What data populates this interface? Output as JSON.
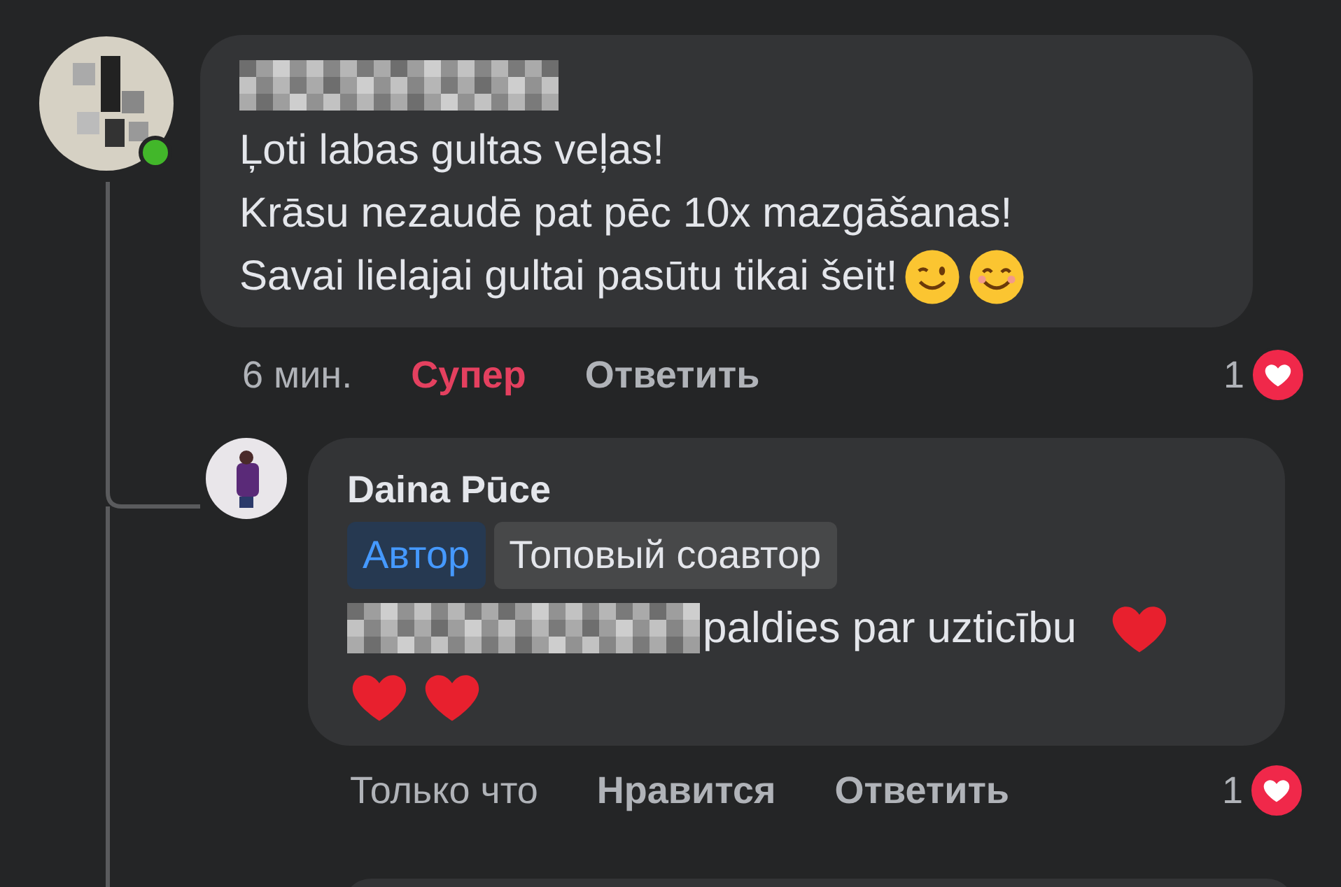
{
  "comments": [
    {
      "online": true,
      "lines": [
        "Ļoti labas gultas veļas!",
        "Krāsu nezaudē pat pēc 10x mazgāšanas!",
        "Savai lielajai gultai pasūtu tikai šeit!"
      ],
      "time": "6 мин.",
      "reaction": {
        "label": "Супер",
        "reacted": true
      },
      "reply": "Ответить",
      "reaction_count": "1"
    },
    {
      "author": "Daina Pūce",
      "author_tags": [
        {
          "label": "Автор",
          "kind": "author"
        },
        {
          "label": "Топовый соавтор",
          "kind": "badge"
        }
      ],
      "lines": [
        "paldies par uzticību"
      ],
      "time": "Только что",
      "reaction": {
        "label": "Нравится",
        "reacted": false
      },
      "reply": "Ответить",
      "reaction_count": "1"
    }
  ]
}
